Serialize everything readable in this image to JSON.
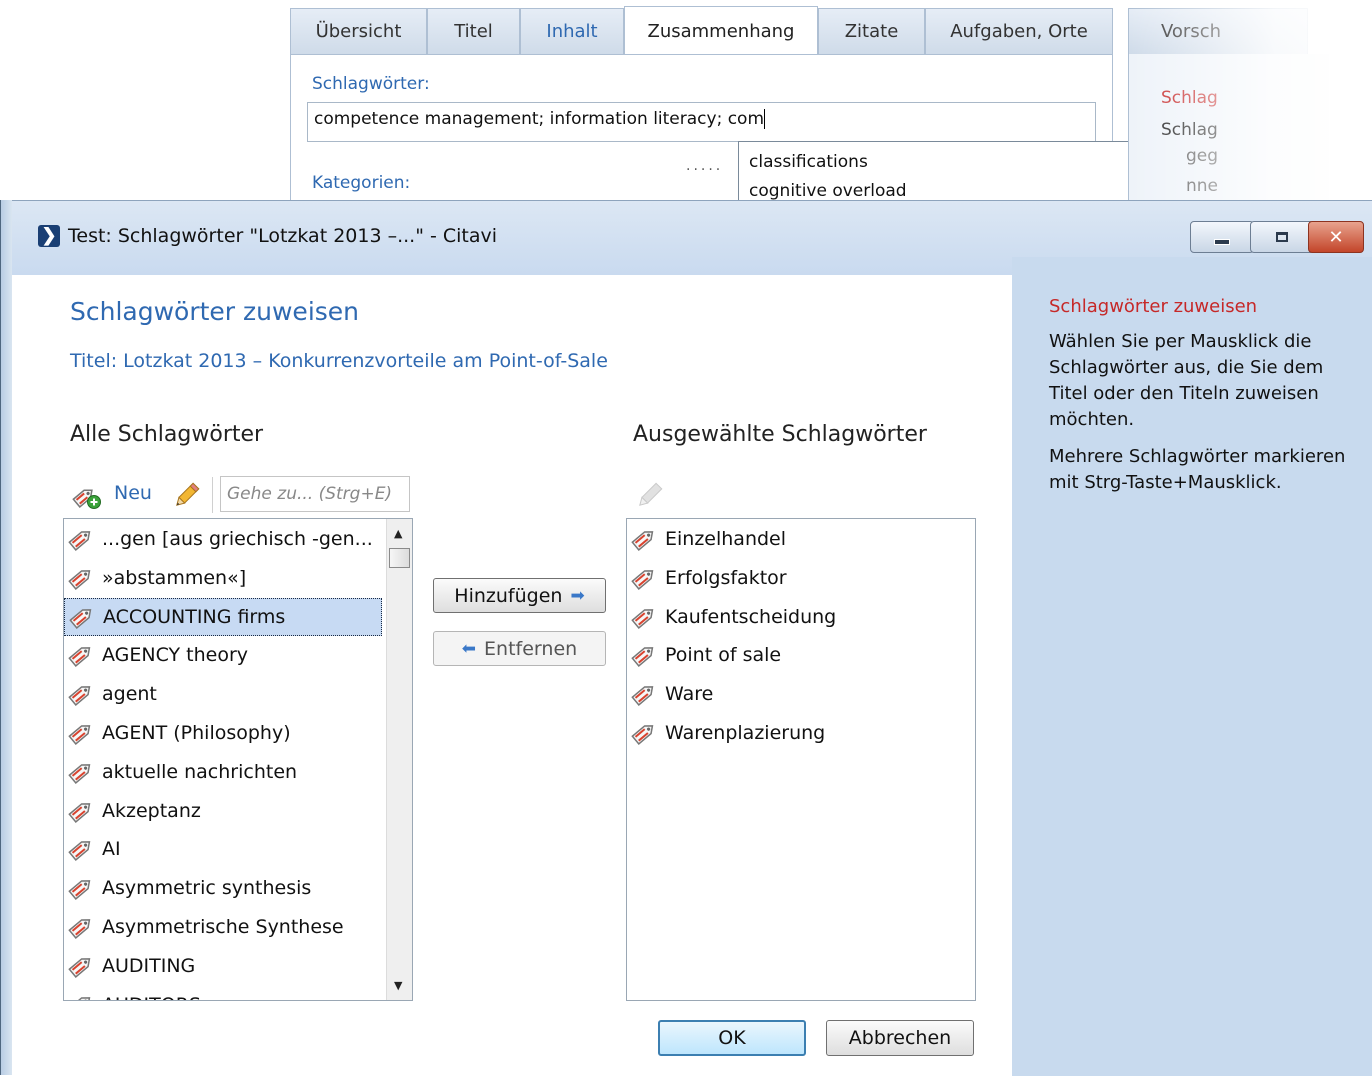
{
  "background_window": {
    "tabs": [
      {
        "label": "Übersicht"
      },
      {
        "label": "Titel"
      },
      {
        "label": "Inhalt"
      },
      {
        "label": "Zusammenhang"
      },
      {
        "label": "Zitate"
      },
      {
        "label": "Aufgaben, Orte"
      }
    ],
    "active_tab": "Zusammenhang",
    "right_tab_label": "Vorsch",
    "keywords_label": "Schlagwörter:",
    "keywords_value": "competence management; information literacy; com",
    "categories_label": "Kategorien:",
    "autocomplete_items": [
      "classifications",
      "cognitive overload"
    ],
    "right_panel": {
      "red_text": "Schlag",
      "line1": "Schlag",
      "line2": "geg",
      "line3": "nne"
    }
  },
  "dialog": {
    "window_title": "Test: Schlagwörter \"Lotzkat 2013 –...\" - Citavi",
    "heading": "Schlagwörter zuweisen",
    "subtitle": "Titel: Lotzkat 2013 – Konkurrenzvorteile am Point-of-Sale",
    "all_keywords_label": "Alle Schlagwörter",
    "selected_keywords_label": "Ausgewählte Schlagwörter",
    "new_label": "Neu",
    "goto_placeholder": "Gehe zu... (Strg+E)",
    "all_keywords": [
      "...gen [aus griechisch -gen...",
      "»abstammen«]",
      "ACCOUNTING firms",
      "AGENCY theory",
      "agent",
      "AGENT (Philosophy)",
      "aktuelle nachrichten",
      "Akzeptanz",
      "AI",
      "Asymmetric synthesis",
      "Asymmetrische Synthese",
      "AUDITING",
      "AUDITORS"
    ],
    "selected_index": 2,
    "selected_keywords": [
      "Einzelhandel",
      "Erfolgsfaktor",
      "Kaufentscheidung",
      "Point of sale",
      "Ware",
      "Warenplazierung"
    ],
    "add_button": "Hinzufügen",
    "remove_button": "Entfernen",
    "ok_button": "OK",
    "cancel_button": "Abbrechen",
    "help": {
      "title": "Schlagwörter zuweisen",
      "paragraph1": "Wählen Sie per Mausklick die Schlagwörter aus, die Sie dem Titel oder den Titeln zuweisen möchten.",
      "paragraph2": "Mehrere Schlagwörter markieren mit Strg-Taste+Mausklick."
    }
  },
  "colors": {
    "accent_blue": "#2f69b1",
    "help_red": "#c62828",
    "help_panel_bg": "#c8daee",
    "selection_bg": "#c7daf3"
  }
}
